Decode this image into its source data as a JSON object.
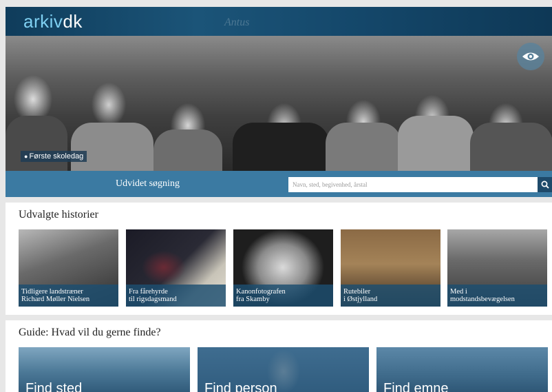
{
  "header": {
    "logo_part1": "arkiv",
    "logo_part2": "dk",
    "watermark": "Antus"
  },
  "hero": {
    "caption": "Første skoledag",
    "eye_icon": "eye-icon",
    "caption_icon": "pin-icon"
  },
  "search": {
    "advanced_label": "Udvidet søgning",
    "placeholder": "Navn, sted, begivenhed, årstal",
    "value": "",
    "button_icon": "search-icon"
  },
  "stories": {
    "title": "Udvalgte historier",
    "items": [
      {
        "label": "Tidligere landstræner\nRichard Møller Nielsen"
      },
      {
        "label": "Fra fårehyrde\ntil rigsdagsmand"
      },
      {
        "label": "Kanonfotografen\nfra Skamby"
      },
      {
        "label": "Rutebiler\ni Østjylland"
      },
      {
        "label": "Med i\nmodstandsbevægelsen"
      }
    ]
  },
  "guide": {
    "title": "Guide: Hvad vil du gerne finde?",
    "items": [
      {
        "label": "Find sted"
      },
      {
        "label": "Find person"
      },
      {
        "label": "Find emne"
      }
    ]
  },
  "colors": {
    "topbar": "#14476a",
    "accent": "#3b7aa2",
    "caption_bg": "#1c4e70",
    "logo_accent": "#7fd0f2"
  }
}
